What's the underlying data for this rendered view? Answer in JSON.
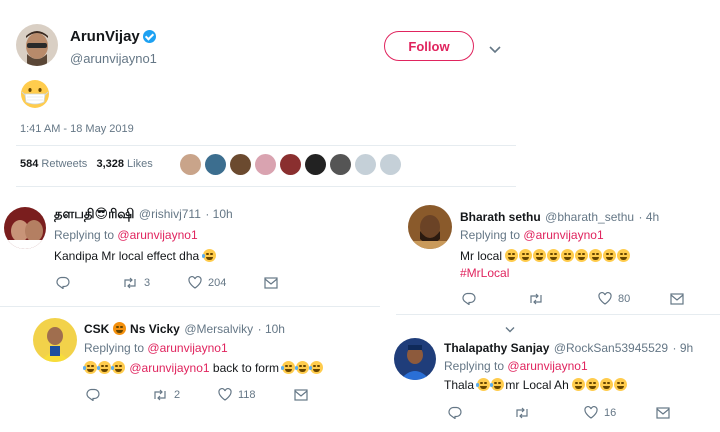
{
  "main_tweet": {
    "author_name": "ArunVijay",
    "author_handle": "@arunvijayno1",
    "follow_label": "Follow",
    "content_emoji": "mask-face-emoji",
    "timestamp": "1:41 AM - 18 May 2019",
    "retweets_count": "584",
    "retweets_label": "Retweets",
    "likes_count": "3,328",
    "likes_label": "Likes"
  },
  "replies": [
    {
      "name": "தளபதி😎ரிஷி",
      "handle": "@rishivj711",
      "time": "· 10h",
      "replying_prefix": "Replying to",
      "replying_to": "@arunvijayno1",
      "text": "Kandipa Mr local effect dha",
      "retweets": "3",
      "likes": "204"
    },
    {
      "name": "Bharath sethu",
      "handle": "@bharath_sethu",
      "time": "· 4h",
      "replying_prefix": "Replying to",
      "replying_to": "@arunvijayno1",
      "text": "Mr local",
      "hashtag": "#MrLocal",
      "retweets": "",
      "likes": "80"
    },
    {
      "name_part1": "CSK",
      "name_part2": "Ns Vicky",
      "handle": "@Mersalviky",
      "time": "· 10h",
      "replying_prefix": "Replying to",
      "replying_to": "@arunvijayno1",
      "mention": "@arunvijayno1",
      "text": "back to form",
      "retweets": "2",
      "likes": "118"
    },
    {
      "name": "Thalapathy Sanjay",
      "handle": "@RockSan53945529",
      "time": "· 9h",
      "replying_prefix": "Replying to",
      "replying_to": "@arunvijayno1",
      "text_part1": "Thala",
      "text_part2": "mr Local Ah",
      "retweets": "",
      "likes": "16"
    }
  ],
  "colors": {
    "accent_pink": "#e0245e",
    "muted": "#657786",
    "verified_blue": "#1da1f2",
    "divider": "#e6ecf0"
  }
}
